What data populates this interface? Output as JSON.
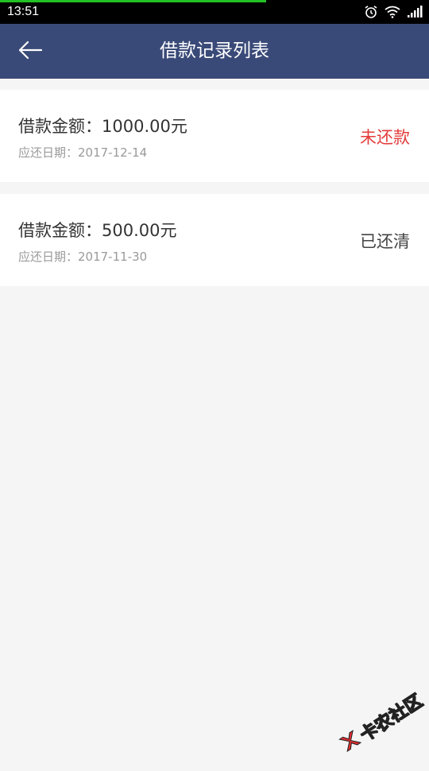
{
  "status_bar": {
    "time": "13:51",
    "progress_color": "#23c023",
    "progress_fraction": 0.62,
    "icons": [
      "alarm-icon",
      "wifi-icon",
      "signal-icon"
    ]
  },
  "app_bar": {
    "title": "借款记录列表",
    "back_icon": "arrow-left-icon",
    "background_color": "#3a4a78"
  },
  "records": [
    {
      "amount_text": "借款金额：1000.00元",
      "due_text": "应还日期：2017-12-14",
      "status": "未还款",
      "status_color": "#e33b3b"
    },
    {
      "amount_text": "借款金额：500.00元",
      "due_text": "应还日期：2017-11-30",
      "status": "已还清",
      "status_color": "#444444"
    }
  ],
  "watermark": {
    "text": "卡农社区",
    "logo_color": "#e03030"
  }
}
